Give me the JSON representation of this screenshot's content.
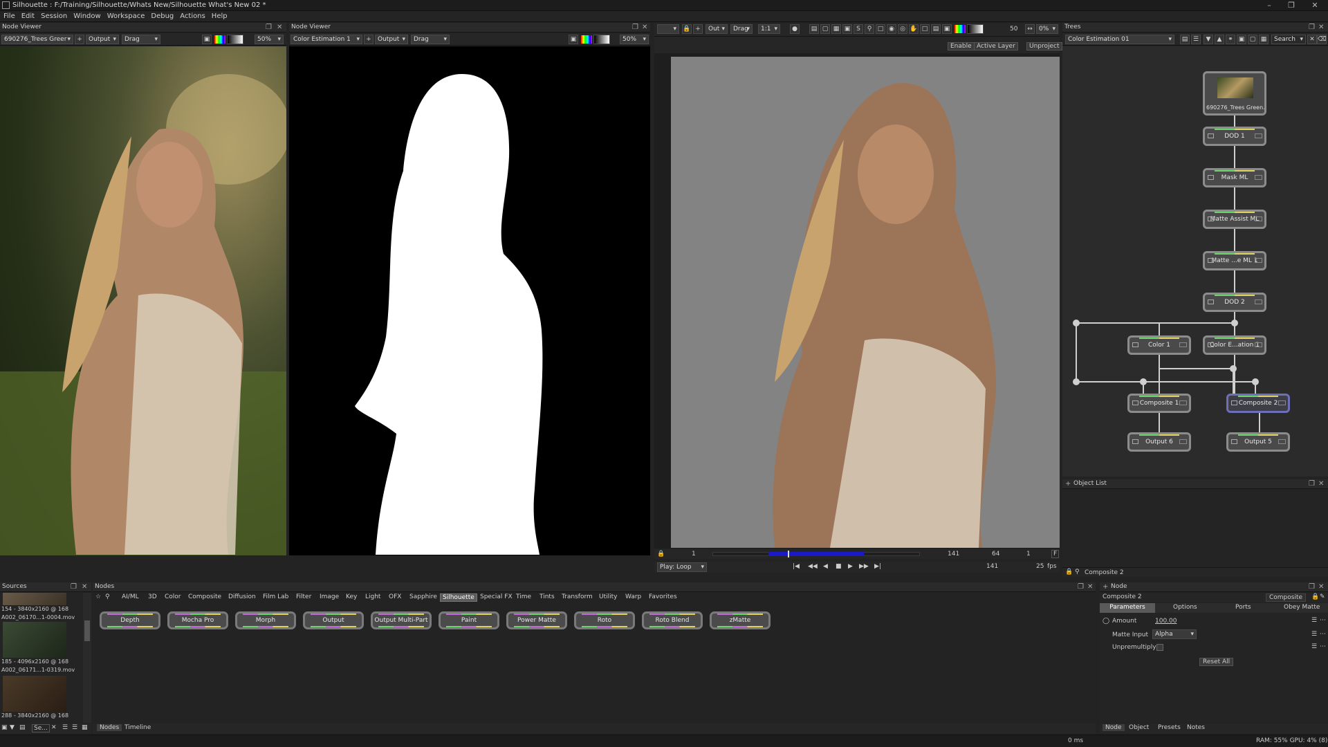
{
  "app": {
    "window_title": "Silhouette : F:/Training/Silhouette/Whats New/Silhouette What's New 02 *"
  },
  "menu": [
    "File",
    "Edit",
    "Session",
    "Window",
    "Workspace",
    "Debug",
    "Actions",
    "Help"
  ],
  "viewer_left": {
    "header": "Node Viewer",
    "source": "690276_Trees Greer",
    "output": "Output",
    "mode": "Drag",
    "zoom": "50%"
  },
  "viewer_mid": {
    "header": "Node Viewer",
    "source": "Color Estimation 1",
    "output": "Output",
    "mode": "Drag",
    "zoom": "50%"
  },
  "viewer_main": {
    "toolbar": {
      "out": "Out",
      "drag": "Drag",
      "ratio": "1:1",
      "frame": "50",
      "zoom": "0%"
    },
    "buttons": {
      "enable": "Enable",
      "active_layer": "Active Layer",
      "unproject": "Unproject"
    },
    "timeline": {
      "start": "1",
      "end": "141",
      "current": "64",
      "step": "1",
      "play": "Play: Loop",
      "out_frame": "141",
      "fps": "25",
      "fps_unit": "fps",
      "f_btn": "F"
    }
  },
  "trees": {
    "header": "Trees",
    "tree": "Color Estimation 01",
    "search_placeholder": "Search",
    "nodes": {
      "source": "690276_Trees Green...",
      "dod1": "DOD 1",
      "mask": "Mask ML",
      "matte_assist": "Matte Assist ML",
      "matte_ml": "Matte ...e ML 1",
      "dod2": "DOD 2",
      "color1": "Color 1",
      "color_est": "Color E...ation 1",
      "comp1": "Composite 1",
      "comp2": "Composite 2",
      "out6": "Output 6",
      "out5": "Output 5"
    }
  },
  "object_list": {
    "header": "Object List",
    "selected": "Composite 2"
  },
  "sources": {
    "header": "Sources",
    "items": [
      {
        "caption": "154 - 3840x2160 @ 168",
        "name": "A002_06170...1-0004.mov"
      },
      {
        "caption": "185 - 4096x2160 @ 168",
        "name": "A002_06171...1-0319.mov"
      },
      {
        "caption": "288 - 3840x2160 @ 168",
        "name": ""
      }
    ],
    "footer": "Se..."
  },
  "nodes_panel": {
    "header": "Nodes",
    "categories": [
      "AI/ML",
      "3D",
      "Color",
      "Composite",
      "Diffusion",
      "Film Lab",
      "Filter",
      "Image",
      "Key",
      "Light",
      "OFX",
      "Sapphire",
      "Silhouette",
      "Special FX",
      "Time",
      "Tints",
      "Transform",
      "Utility",
      "Warp",
      "Favorites"
    ],
    "selected_category": "Silhouette",
    "palette": [
      "Depth",
      "Mocha Pro",
      "Morph",
      "Output",
      "Output Multi-Part",
      "Paint",
      "Power Matte",
      "Roto",
      "Roto Blend",
      "zMatte"
    ],
    "bottom_tabs": [
      "Nodes",
      "Timeline"
    ]
  },
  "node_panel": {
    "header": "Node",
    "node_name": "Composite 2",
    "node_type": "Composite",
    "tabs": [
      "Parameters",
      "Options",
      "Ports",
      "Obey Matte"
    ],
    "amount_label": "Amount",
    "amount_value": "100.00",
    "matte_input_label": "Matte Input",
    "matte_input_value": "Alpha",
    "unpremultiply_label": "Unpremultiply",
    "reset": "Reset All",
    "bottom_tabs": [
      "Node",
      "Object",
      "Presets",
      "Notes"
    ]
  },
  "status": {
    "time": "0 ms",
    "ram": "RAM: 55% GPU: 4% (8)"
  },
  "colors": {
    "accent": "#6d70b8",
    "bg": "#232323",
    "matte_bg": "#000000",
    "comp_bg": "#838383",
    "timeline_range": "#1a1ac8"
  }
}
